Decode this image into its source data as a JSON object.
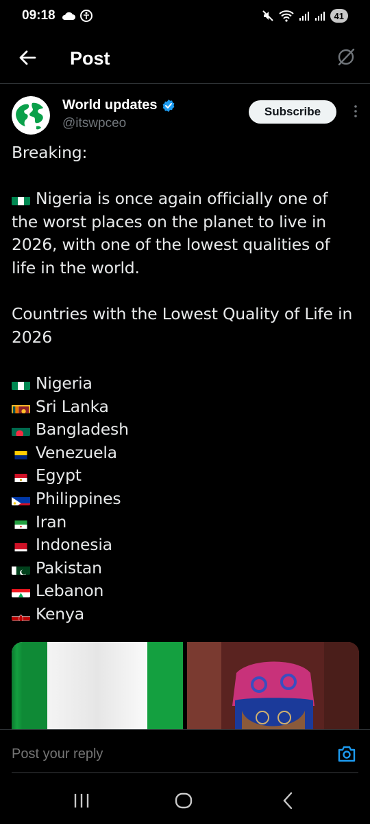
{
  "status_bar": {
    "time": "09:18",
    "battery": "41",
    "icons": [
      "cloud-icon",
      "accessibility-icon",
      "mute-icon",
      "wifi-icon",
      "signal-icon",
      "signal-icon",
      "battery-icon"
    ]
  },
  "header": {
    "title": "Post",
    "back_icon": "arrow-left-icon",
    "grok_icon": "grok-icon"
  },
  "author": {
    "name": "World updates",
    "handle": "@itswpceo",
    "verified": true,
    "subscribe_label": "Subscribe"
  },
  "post": {
    "intro": "Breaking:",
    "paragraph1": "Nigeria is once again officially one of the worst places on the planet to live in 2026, with one of the lowest qualities of life in the world.",
    "list_title": "Countries with the Lowest Quality of Life in 2026",
    "countries": [
      {
        "name": "Nigeria",
        "flag": "nigeria"
      },
      {
        "name": "Sri Lanka",
        "flag": "sri-lanka"
      },
      {
        "name": "Bangladesh",
        "flag": "bangladesh"
      },
      {
        "name": "Venezuela",
        "flag": "venezuela"
      },
      {
        "name": "Egypt",
        "flag": "egypt"
      },
      {
        "name": "Philippines",
        "flag": "philippines"
      },
      {
        "name": "Iran",
        "flag": "iran"
      },
      {
        "name": "Indonesia",
        "flag": "indonesia"
      },
      {
        "name": "Pakistan",
        "flag": "pakistan"
      },
      {
        "name": "Lebanon",
        "flag": "lebanon"
      },
      {
        "name": "Kenya",
        "flag": "kenya"
      }
    ]
  },
  "reply": {
    "placeholder": "Post your reply",
    "camera_icon": "camera-icon"
  },
  "colors": {
    "background": "#000000",
    "text": "#e7e9ea",
    "muted": "#71767b",
    "accent": "#1d9bf0",
    "divider": "#2f3336"
  }
}
